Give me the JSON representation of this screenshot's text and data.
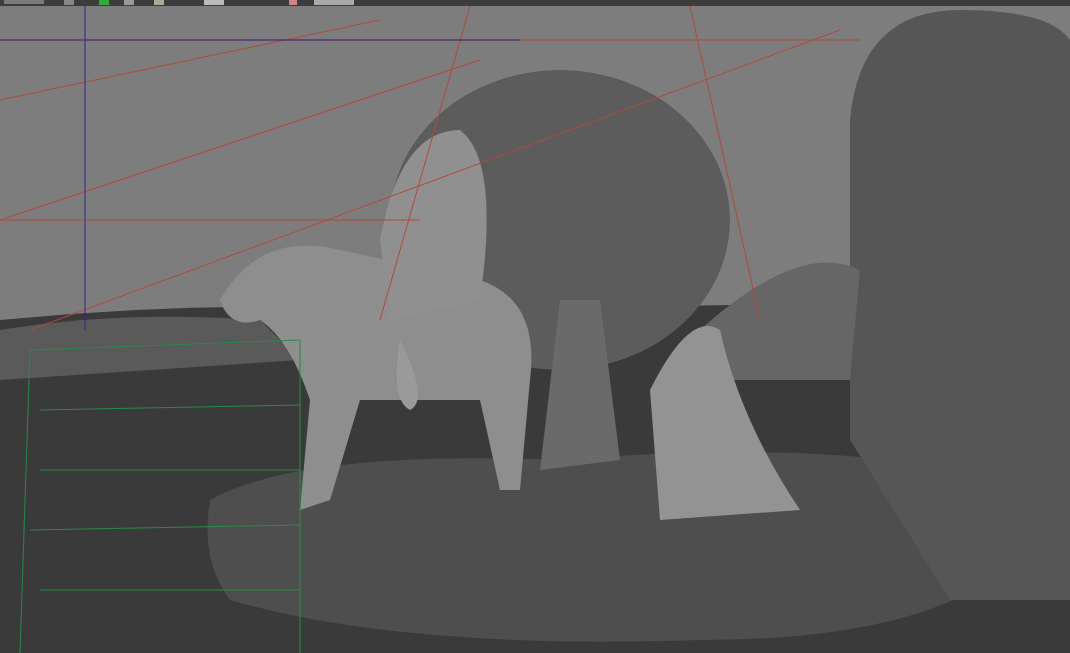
{
  "viewport": {
    "show_grid": true,
    "wireframe_selected": true
  }
}
